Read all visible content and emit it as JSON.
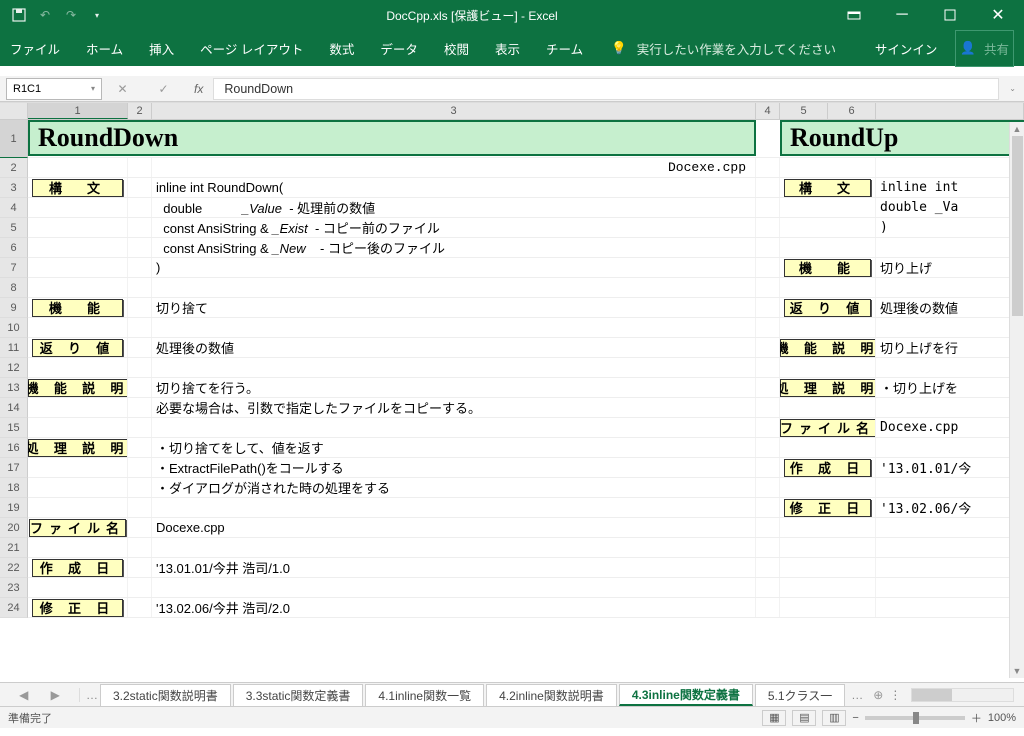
{
  "app": {
    "title": "DocCpp.xls  [保護ビュー] - Excel",
    "signin": "サインイン",
    "share": "共有"
  },
  "ribbon": {
    "file": "ファイル",
    "home": "ホーム",
    "insert": "挿入",
    "layout": "ページ レイアウト",
    "formulas": "数式",
    "data": "データ",
    "review": "校閲",
    "view": "表示",
    "team": "チーム",
    "tellme": "実行したい作業を入力してください"
  },
  "fx": {
    "namebox": "R1C1",
    "formula": "RoundDown"
  },
  "cols": {
    "c1": "1",
    "c2": "2",
    "c3": "3",
    "c4": "4",
    "c5": "5",
    "c6": "6"
  },
  "rows": [
    "1",
    "2",
    "3",
    "4",
    "5",
    "6",
    "7",
    "8",
    "9",
    "10",
    "11",
    "12",
    "13",
    "14",
    "15",
    "16",
    "17",
    "18",
    "19",
    "20",
    "21",
    "22",
    "23",
    "24"
  ],
  "left": {
    "title": "RoundDown",
    "srcfile": "Docexe.cpp",
    "content": [
      {
        "row": 3,
        "label": "構　文",
        "text": "inline int RoundDown("
      },
      {
        "row": 4,
        "text": "  double           _Value  - 処理前の数値"
      },
      {
        "row": 5,
        "text": "  const AnsiString & _Exist  - コピー前のファイル"
      },
      {
        "row": 6,
        "text": "  const AnsiString & _New    - コピー後のファイル"
      },
      {
        "row": 7,
        "text": ")"
      },
      {
        "row": 9,
        "label": "機　能",
        "text": "切り捨て"
      },
      {
        "row": 11,
        "label": "返 り 値",
        "text": "処理後の数値"
      },
      {
        "row": 13,
        "label": "機 能 説 明",
        "text": "切り捨てを行う。"
      },
      {
        "row": 14,
        "text": "必要な場合は、引数で指定したファイルをコピーする。"
      },
      {
        "row": 16,
        "label": "処 理 説 明",
        "text": "・切り捨てをして、値を返す"
      },
      {
        "row": 17,
        "text": "・ExtractFilePath()をコールする"
      },
      {
        "row": 18,
        "text": "・ダイアログが消された時の処理をする"
      },
      {
        "row": 20,
        "label": "ファイル名",
        "text": "Docexe.cpp"
      },
      {
        "row": 22,
        "label": "作 成 日",
        "text": "'13.01.01/今井 浩司/1.0"
      },
      {
        "row": 24,
        "label": "修 正 日",
        "text": "'13.02.06/今井 浩司/2.0"
      }
    ]
  },
  "right": {
    "title": "RoundUp",
    "content": [
      {
        "row": 3,
        "label": "構　文",
        "text": "inline int"
      },
      {
        "row": 4,
        "text": "  double _Va"
      },
      {
        "row": 5,
        "text": ")"
      },
      {
        "row": 7,
        "label": "機　能",
        "text": "切り上げ"
      },
      {
        "row": 9,
        "label": "返 り 値",
        "text": "処理後の数値"
      },
      {
        "row": 11,
        "label": "機 能 説 明",
        "text": "切り上げを行"
      },
      {
        "row": 13,
        "label": "処 理 説 明",
        "text": "・切り上げを"
      },
      {
        "row": 15,
        "label": "ファイル名",
        "text": "Docexe.cpp"
      },
      {
        "row": 17,
        "label": "作 成 日",
        "text": "'13.01.01/今"
      },
      {
        "row": 19,
        "label": "修 正 日",
        "text": "'13.02.06/今"
      }
    ]
  },
  "tabs": {
    "t1": "3.2static関数説明書",
    "t2": "3.3static関数定義書",
    "t3": "4.1inline関数一覧",
    "t4": "4.2inline関数説明書",
    "t5": "4.3inline関数定義書",
    "t6": "5.1クラス一"
  },
  "status": {
    "ready": "準備完了",
    "zoom": "100%"
  }
}
